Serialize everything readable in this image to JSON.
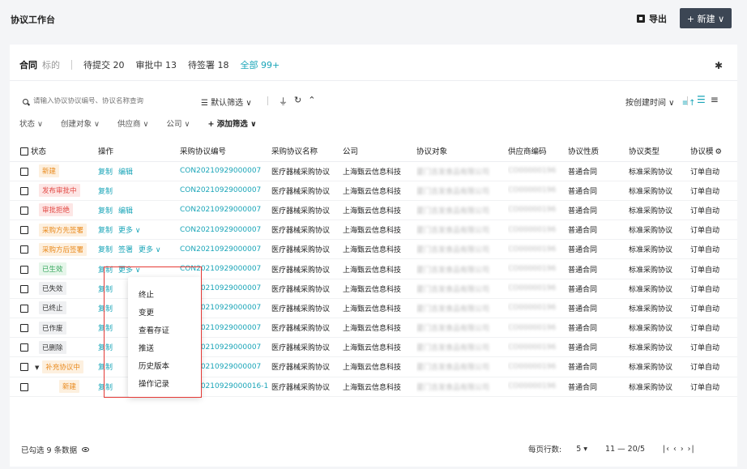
{
  "header": {
    "title": "协议工作台",
    "export_label": "导出",
    "new_label": "+ 新建 ∨"
  },
  "tabs": {
    "primary": "合同",
    "secondary": "标的",
    "items": [
      {
        "label": "待提交 20"
      },
      {
        "label": "审批中 13"
      },
      {
        "label": "待签署 18"
      },
      {
        "label": "全部 99+"
      }
    ]
  },
  "search": {
    "placeholder": "请输入协议协议编号、协议名称查询"
  },
  "toolbar": {
    "default_filter": "☰ 默认筛选 ∨",
    "sort_label": "按创建时间 ∨",
    "sort_dir": "≡↑"
  },
  "filters": {
    "status": "状态 ∨",
    "creator": "创建对象 ∨",
    "supplier": "供应商 ∨",
    "company": "公司 ∨",
    "add": "+ 添加筛选 ∨"
  },
  "columns": [
    "状态",
    "操作",
    "采购协议编号",
    "采购协议名称",
    "公司",
    "协议对象",
    "供应商编码",
    "协议性质",
    "协议类型",
    "协议模"
  ],
  "rows": [
    {
      "status": "新建",
      "status_color": "#e98a1e",
      "ops": [
        "复制",
        "编辑"
      ],
      "code": "CON20210929000007",
      "name": "医疗器械采购协议",
      "company": "上海甄云信息科技",
      "party": "厦门吉发食品有限公司",
      "supplier": "CO00000196",
      "nature": "普通合同",
      "type": "标准采购协议",
      "template": "订单自动"
    },
    {
      "status": "发布审批中",
      "status_color": "#e24a45",
      "ops": [
        "复制"
      ],
      "code": "CON20210929000007",
      "name": "医疗器械采购协议",
      "company": "上海甄云信息科技",
      "party": "厦门吉发食品有限公司",
      "supplier": "CO00000196",
      "nature": "普通合同",
      "type": "标准采购协议",
      "template": "订单自动"
    },
    {
      "status": "审批拒绝",
      "status_color": "#e24a45",
      "ops": [
        "复制",
        "编辑"
      ],
      "code": "CON20210929000007",
      "name": "医疗器械采购协议",
      "company": "上海甄云信息科技",
      "party": "厦门吉发食品有限公司",
      "supplier": "CO00000196",
      "nature": "普通合同",
      "type": "标准采购协议",
      "template": "订单自动"
    },
    {
      "status": "采购方先签署",
      "status_color": "#e98a1e",
      "ops": [
        "复制",
        "更多 ∨"
      ],
      "code": "CON20210929000007",
      "name": "医疗器械采购协议",
      "company": "上海甄云信息科技",
      "party": "厦门吉发食品有限公司",
      "supplier": "CO00000196",
      "nature": "普通合同",
      "type": "标准采购协议",
      "template": "订单自动"
    },
    {
      "status": "采购方后签署",
      "status_color": "#e98a1e",
      "ops": [
        "复制",
        "签署",
        "更多 ∨"
      ],
      "code": "CON20210929000007",
      "name": "医疗器械采购协议",
      "company": "上海甄云信息科技",
      "party": "厦门吉发食品有限公司",
      "supplier": "CO00000196",
      "nature": "普通合同",
      "type": "标准采购协议",
      "template": "订单自动"
    },
    {
      "status": "已生效",
      "status_color": "#3aa860",
      "ops": [
        "复制",
        "更多 ∨"
      ],
      "code": "CON20210929000007",
      "name": "医疗器械采购协议",
      "company": "上海甄云信息科技",
      "party": "厦门吉发食品有限公司",
      "supplier": "CO00000196",
      "nature": "普通合同",
      "type": "标准采购协议",
      "template": "订单自动"
    },
    {
      "status": "已失效",
      "status_color": "#333333",
      "ops": [
        "复制"
      ],
      "code": "CON20210929000007",
      "name": "医疗器械采购协议",
      "company": "上海甄云信息科技",
      "party": "厦门吉发食品有限公司",
      "supplier": "CO00000196",
      "nature": "普通合同",
      "type": "标准采购协议",
      "template": "订单自动"
    },
    {
      "status": "已终止",
      "status_color": "#333333",
      "ops": [
        "复制"
      ],
      "code": "CON20210929000007",
      "name": "医疗器械采购协议",
      "company": "上海甄云信息科技",
      "party": "厦门吉发食品有限公司",
      "supplier": "CO00000196",
      "nature": "普通合同",
      "type": "标准采购协议",
      "template": "订单自动"
    },
    {
      "status": "已作废",
      "status_color": "#333333",
      "ops": [
        "复制"
      ],
      "code": "CON20210929000007",
      "name": "医疗器械采购协议",
      "company": "上海甄云信息科技",
      "party": "厦门吉发食品有限公司",
      "supplier": "CO00000196",
      "nature": "普通合同",
      "type": "标准采购协议",
      "template": "订单自动"
    },
    {
      "status": "已删除",
      "status_color": "#333333",
      "ops": [
        "复制"
      ],
      "code": "CON20210929000007",
      "name": "医疗器械采购协议",
      "company": "上海甄云信息科技",
      "party": "厦门吉发食品有限公司",
      "supplier": "CO00000196",
      "nature": "普通合同",
      "type": "标准采购协议",
      "template": "订单自动"
    },
    {
      "status": "补充协议中",
      "status_color": "#e98a1e",
      "ops": [
        "复制"
      ],
      "code": "CON20210929000007",
      "name": "医疗器械采购协议",
      "company": "上海甄云信息科技",
      "party": "厦门吉发食品有限公司",
      "supplier": "CO00000196",
      "nature": "普通合同",
      "type": "标准采购协议",
      "template": "订单自动",
      "expandable": true
    },
    {
      "status": "新建",
      "status_color": "#e98a1e",
      "ops": [
        "复制"
      ],
      "code": "CON20210929000016-1",
      "name": "医疗器械采购协议",
      "company": "上海甄云信息科技",
      "party": "厦门吉发食品有限公司",
      "supplier": "CO00000196",
      "nature": "普通合同",
      "type": "标准采购协议",
      "template": "订单自动",
      "child": true
    }
  ],
  "more_menu": [
    "终止",
    "变更",
    "查看存证",
    "推送",
    "历史版本",
    "操作记录"
  ],
  "footer": {
    "selected": "已勾选 9 条数据",
    "per_page_label": "每页行数:",
    "per_page_value": "5 ▾",
    "range": "11 — 20/5",
    "nav": "|‹  ‹   ›  ›|"
  }
}
